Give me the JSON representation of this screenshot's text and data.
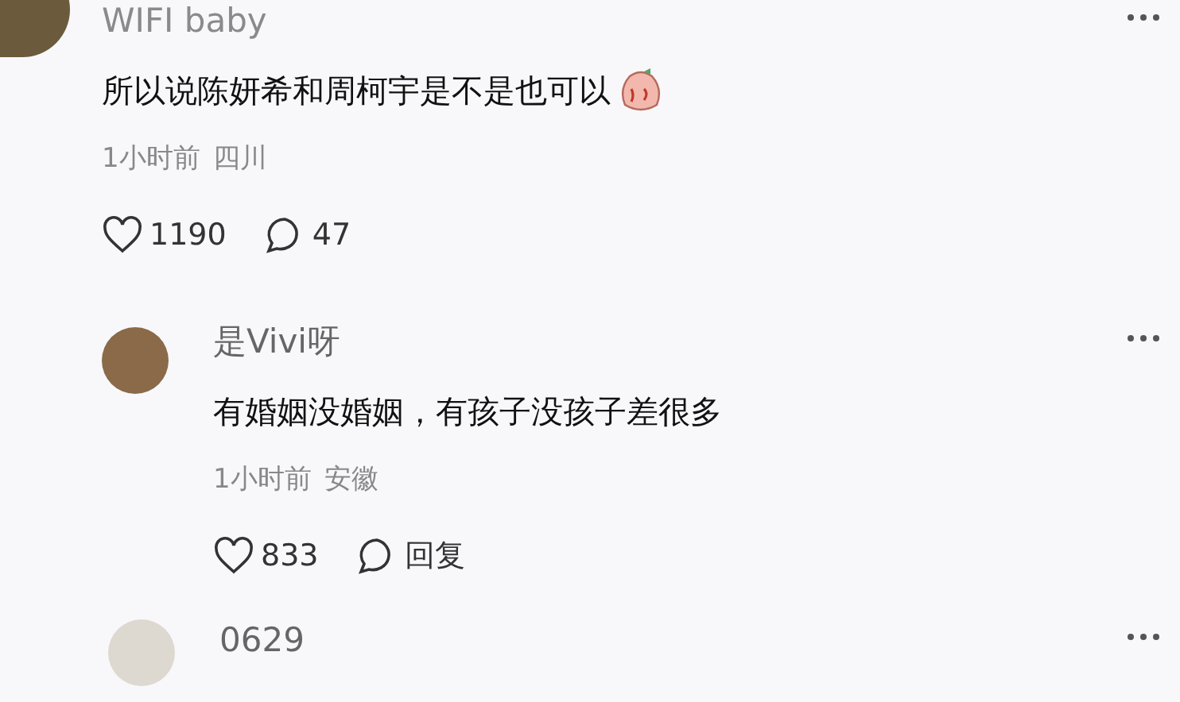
{
  "comments": [
    {
      "user": "WIFI baby",
      "text": "所以说陈妍希和周柯宇是不是也可以",
      "time": "1小时前",
      "location": "四川",
      "likes": "1190",
      "comment_count": "47",
      "replies": [
        {
          "user": "是Vivi呀",
          "text": "有婚姻没婚姻，有孩子没孩子差很多",
          "time": "1小时前",
          "location": "安徽",
          "likes": "833",
          "comment_count": "回复"
        }
      ]
    },
    {
      "user": "0629"
    }
  ]
}
